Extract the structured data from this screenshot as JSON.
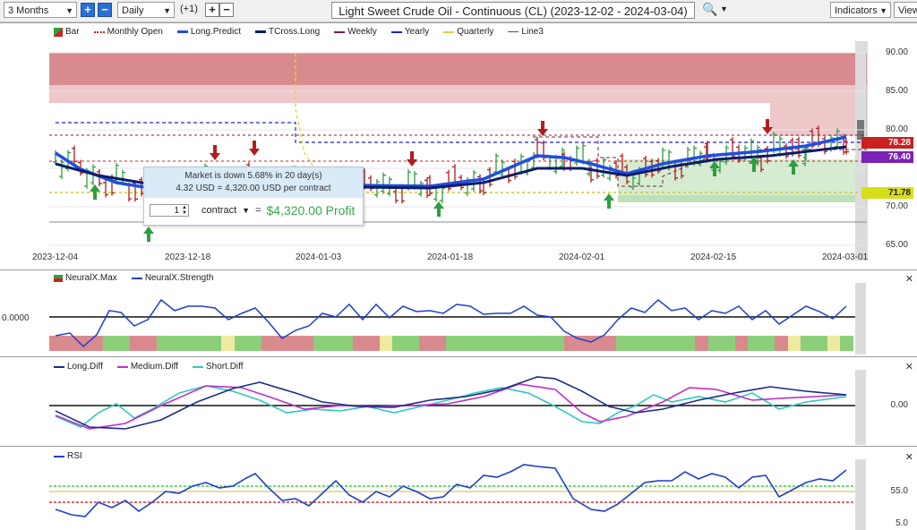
{
  "toolbar": {
    "period_select": "3 Months",
    "interval_select": "Daily",
    "offset_label": "(+1)",
    "plus": "+",
    "minus": "−",
    "chart_title": "Light Sweet Crude Oil - Continuous (CL) (2023-12-02 - 2024-03-04)",
    "indicators_button": "Indicators",
    "view_button": "View"
  },
  "main_panel": {
    "legend": [
      {
        "label": "Bar",
        "color": "#2e9e3f"
      },
      {
        "label": "Monthly Open",
        "color": "#cc2222"
      },
      {
        "label": "Long.Predict",
        "color": "#1f4fe0"
      },
      {
        "label": "TCross.Long",
        "color": "#0c1d6a"
      },
      {
        "label": "Weekly",
        "color": "#7a1f4a"
      },
      {
        "label": "Yearly",
        "color": "#2020cc"
      },
      {
        "label": "Quarterly",
        "color": "#e0d040"
      },
      {
        "label": "Line3",
        "color": "#555555"
      }
    ],
    "y_ticks": [
      "90.00",
      "85.00",
      "80.00",
      "75.00",
      "70.00",
      "65.00"
    ],
    "x_ticks": [
      "2023-12-04",
      "2023-12-18",
      "2024-01-03",
      "2024-01-18",
      "2024-02-01",
      "2024-02-15",
      "2024-03-01"
    ],
    "price_tags": [
      {
        "value": "78.28",
        "color": "#cc1f1f"
      },
      {
        "value": "76.40",
        "color": "#7b22b8"
      },
      {
        "value": "71.78",
        "color": "#d8dd1a",
        "text_color": "#222222"
      }
    ]
  },
  "tooltip": {
    "line1": "Market is down 5.68% in 20 day(s)",
    "line2": "4.32 USD = 4,320.00 USD per contract",
    "quantity": "1",
    "contract_label": "contract",
    "equals": "=",
    "profit": "$4,320.00 Profit"
  },
  "panel_neuralx": {
    "legend": [
      {
        "label": "NeuralX.Max",
        "color": "#cc2222"
      },
      {
        "label": "NeuralX.Strength",
        "color": "#1f3fd0"
      }
    ],
    "y_label": "0.0000"
  },
  "panel_diff": {
    "legend": [
      {
        "label": "Long.Diff",
        "color": "#1a2e8a"
      },
      {
        "label": "Medium.Diff",
        "color": "#c030c8"
      },
      {
        "label": "Short.Diff",
        "color": "#30c8c0"
      }
    ],
    "y_label": "0.00"
  },
  "panel_rsi": {
    "legend": [
      {
        "label": "RSI",
        "color": "#1f3fd0"
      }
    ],
    "y_labels": [
      "55.0",
      "5.0"
    ]
  },
  "close_glyph": "✕",
  "colors": {
    "bull": "#2e9e3f",
    "bear": "#b01d1d",
    "long_predict": "#1f4fe0",
    "tcross_long": "#0c1d6a"
  }
}
